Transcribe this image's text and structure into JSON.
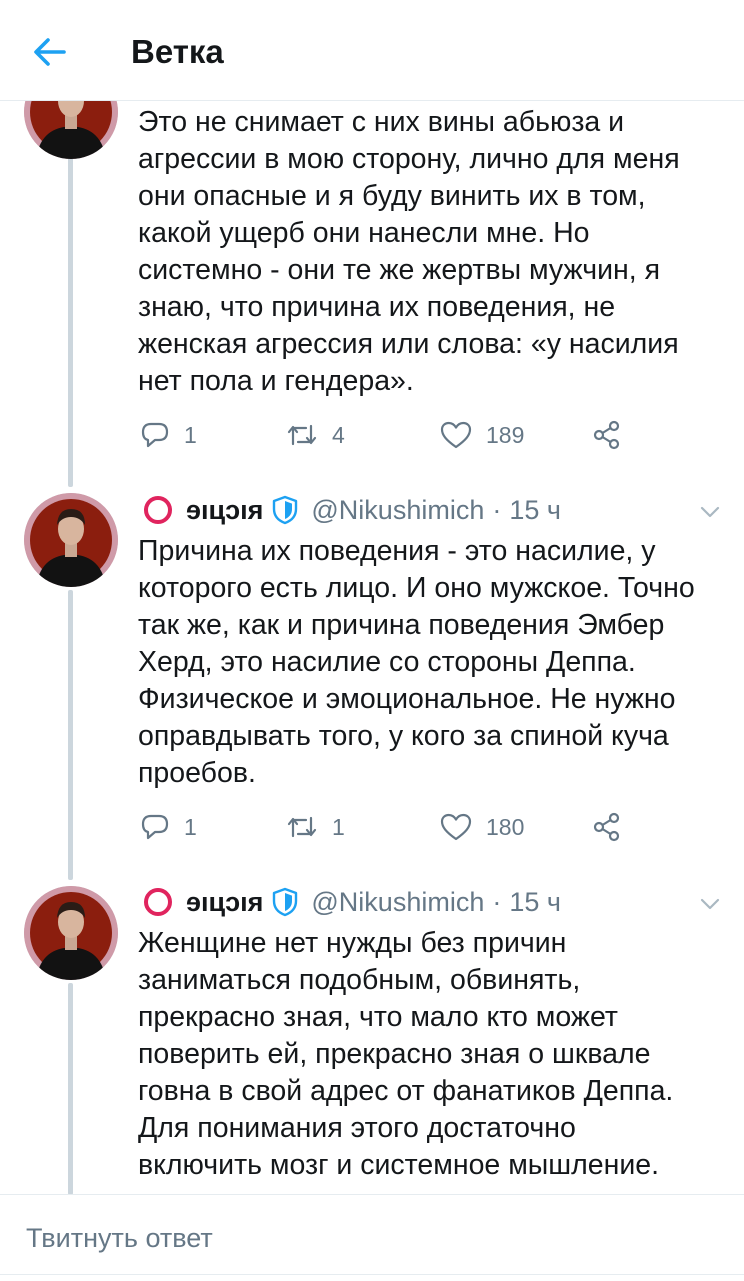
{
  "header": {
    "title": "Ветка",
    "back_icon": "arrow-left-icon"
  },
  "colors": {
    "accent": "#1da1f2",
    "text": "#14171a",
    "muted": "#657786",
    "thread_line": "#ccd6dd",
    "red_circle": "#e0245e"
  },
  "tweets": [
    {
      "text": "Это не снимает с них вины абьюза и\nагрессии в мою сторону, лично для меня\nони опасные и я буду винить их в том,\nкакой ущерб они нанесли мне. Но\nсистемно - они те же жертвы мужчин, я\nзнаю, что причина их поведения, не\nженская агрессия или слова: «у насилия\nнет пола и гендера».",
      "replies": "1",
      "retweets": "4",
      "likes": "189"
    },
    {
      "display_name": "ɘıцɔıя",
      "handle": "@Nikushimich",
      "dot": "·",
      "time": "15 ч",
      "text": "Причина их поведения - это насилие, у\nкоторого есть лицо. И оно мужское. Точно\nтак же, как и причина поведения Эмбер\nХерд, это насилие со стороны Деппа.\nФизическое и эмоциональное. Не нужно\nоправдывать того, у кого за спиной куча\nпроебов.",
      "replies": "1",
      "retweets": "1",
      "likes": "180"
    },
    {
      "display_name": "ɘıцɔıя",
      "handle": "@Nikushimich",
      "dot": "·",
      "time": "15 ч",
      "text": "Женщине нет нужды без причин\nзаниматься подобным, обвинять,\nпрекрасно зная, что мало кто может\nповерить ей, прекрасно зная о шквале\nговна в свой адрес от фанатиков Деппа.\nДля понимания этого достаточно\nвключить мозг и системное мышление."
    }
  ],
  "reply_bar": {
    "placeholder": "Твитнуть ответ"
  }
}
